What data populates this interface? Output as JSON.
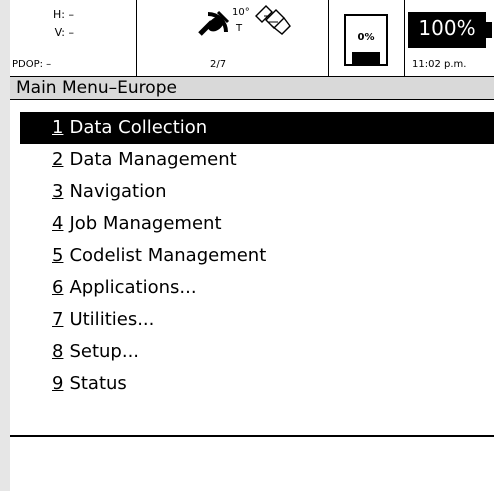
{
  "status": {
    "h_label": "H: –",
    "v_label": "V: –",
    "pdop_label": "PDOP: –",
    "sat_elevation": "10°",
    "sat_tracked": "T",
    "sat_count": "2/7",
    "memory_percent": "0%",
    "battery_percent": "100%",
    "time": "11:02 p.m."
  },
  "menu": {
    "title": "Main Menu–Europe",
    "items": [
      {
        "num": "1",
        "label": "Data Collection",
        "selected": true
      },
      {
        "num": "2",
        "label": "Data Management"
      },
      {
        "num": "3",
        "label": "Navigation"
      },
      {
        "num": "4",
        "label": "Job Management"
      },
      {
        "num": "5",
        "label": "Codelist Management"
      },
      {
        "num": "6",
        "label": "Applications..."
      },
      {
        "num": "7",
        "label": "Utilities..."
      },
      {
        "num": "8",
        "label": "Setup..."
      },
      {
        "num": "9",
        "label": "Status"
      }
    ]
  },
  "colors": {
    "selection": "#000000",
    "header_bg": "#d9d9d9"
  },
  "icons": [
    "satellite-icon",
    "tilt-sensor-icon",
    "memory-card-icon",
    "battery-icon"
  ]
}
